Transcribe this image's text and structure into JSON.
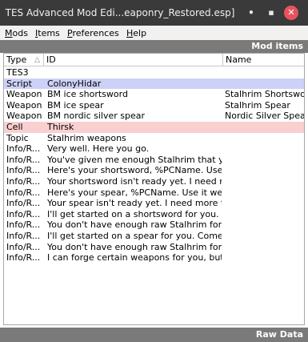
{
  "window": {
    "title": "TES Advanced Mod Edi...eaponry_Restored.esp]",
    "min_glyph": "•",
    "max_glyph": "▪",
    "close_glyph": "✕"
  },
  "menu": [
    {
      "label": "Mods",
      "underline": "M",
      "rest": "ods"
    },
    {
      "label": "Items",
      "underline": "I",
      "rest": "tems"
    },
    {
      "label": "Preferences",
      "underline": "P",
      "rest": "references"
    },
    {
      "label": "Help",
      "underline": "H",
      "rest": "elp"
    }
  ],
  "sections": {
    "top": "Mod items",
    "bottom": "Raw Data"
  },
  "columns": {
    "type": "Type",
    "id": "ID",
    "name": "Name"
  },
  "rows": [
    {
      "type": "TES3",
      "id": "",
      "name": "",
      "highlight": ""
    },
    {
      "type": "Script",
      "id": "ColonyHidar",
      "name": "",
      "highlight": "#cdd1f7"
    },
    {
      "type": "Weapon",
      "id": "BM ice shortsword",
      "name": "Stalhrim Shortsword",
      "highlight": ""
    },
    {
      "type": "Weapon",
      "id": "BM ice spear",
      "name": "Stalhrim Spear",
      "highlight": ""
    },
    {
      "type": "Weapon",
      "id": "BM nordic silver spear",
      "name": "Nordic Silver Spear",
      "highlight": ""
    },
    {
      "type": "Cell",
      "id": "Thirsk",
      "name": "",
      "highlight": "#f9cfcf"
    },
    {
      "type": "Topic",
      "id": "Stalhrim weapons",
      "name": "",
      "highlight": ""
    },
    {
      "type": "Info/R...",
      "id": "Very well. Here you go.",
      "name": "",
      "highlight": ""
    },
    {
      "type": "Info/R...",
      "id": "You've given me enough Stalhrim that you ...",
      "name": "",
      "highlight": ""
    },
    {
      "type": "Info/R...",
      "id": "Here's your shortsword, %PCName. Use it ...",
      "name": "",
      "highlight": ""
    },
    {
      "type": "Info/R...",
      "id": "Your shortsword isn't ready yet. I need more...",
      "name": "",
      "highlight": ""
    },
    {
      "type": "Info/R...",
      "id": "Here's your spear, %PCName. Use it well.",
      "name": "",
      "highlight": ""
    },
    {
      "type": "Info/R...",
      "id": "Your spear isn't ready yet. I need more time ...",
      "name": "",
      "highlight": ""
    },
    {
      "type": "Info/R...",
      "id": "I'll get started on a shortsword for you. Com...",
      "name": "",
      "highlight": ""
    },
    {
      "type": "Info/R...",
      "id": "You don't have enough raw Stalhrim for me...",
      "name": "",
      "highlight": ""
    },
    {
      "type": "Info/R...",
      "id": "I'll get started on a spear for you. Come bac...",
      "name": "",
      "highlight": ""
    },
    {
      "type": "Info/R...",
      "id": "You don't have enough raw Stalhrim for me...",
      "name": "",
      "highlight": ""
    },
    {
      "type": "Info/R...",
      "id": "I can forge certain weapons for you, but yo...",
      "name": "",
      "highlight": ""
    }
  ]
}
